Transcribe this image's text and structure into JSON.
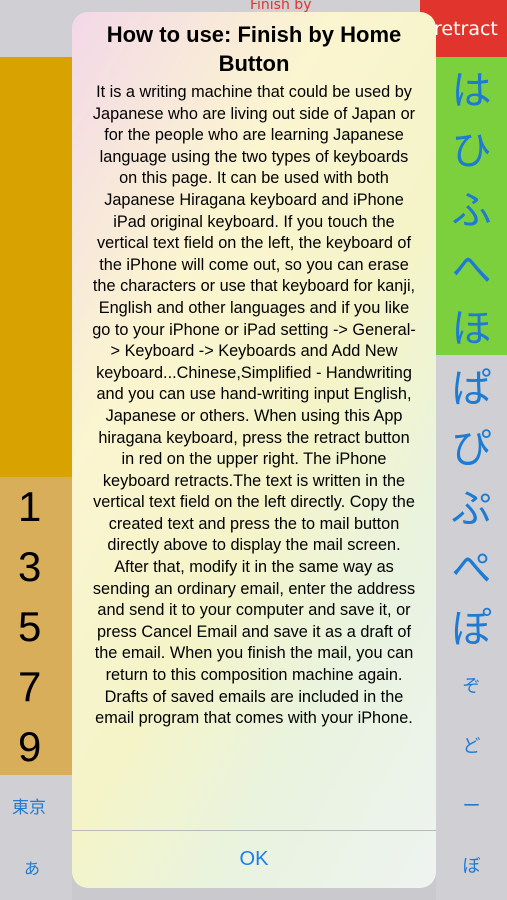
{
  "background": {
    "top_label": "Finish by",
    "retract_label": "retract",
    "numbers": [
      "1",
      "3",
      "5",
      "7",
      "9"
    ],
    "tokyo_label": "東京",
    "a_label": "あ",
    "hiragana": [
      "は",
      "ひ",
      "ふ",
      "へ",
      "ほ",
      "ぱ",
      "ぴ",
      "ぷ",
      "ぺ",
      "ぽ",
      "ぞ",
      "ど",
      "ー",
      "ぼ"
    ]
  },
  "dialog": {
    "title": "How to use: Finish by Home Button",
    "body": "It is a writing machine that could be used by Japanese who are living out side of Japan or for the people who are learning Japanese language using the two types of keyboards on this page. It can be used with both Japanese Hiragana keyboard and iPhone iPad original keyboard. If you touch the vertical text field on the left, the keyboard of the iPhone will come out, so you can erase the characters or use that keyboard for kanji, English and other languages and if you like go to your iPhone or iPad setting -> General-> Keyboard -> Keyboards and Add New keyboard...Chinese,Simplified - Handwriting and you can use hand-writing input English, Japanese or others. When using this App hiragana keyboard, press the retract button in red on the upper right. The iPhone keyboard retracts.The text is written in the vertical text field on the left directly. Copy the created text and press the to mail button directly above to display the mail screen. After that, modify it in the same way as sending an ordinary email, enter the address and send it to your computer and save it, or press Cancel Email and save it as a draft of the email. When you finish the mail, you can return to this composition machine again. Drafts of saved emails are included in the email program that comes with your iPhone.",
    "ok_label": "OK"
  },
  "colors": {
    "retract_red": "#e0342c",
    "key_yellow": "#d8a200",
    "number_tan": "#d9ae5a",
    "key_green": "#7ccf3d",
    "ios_blue": "#1a7ef0"
  }
}
